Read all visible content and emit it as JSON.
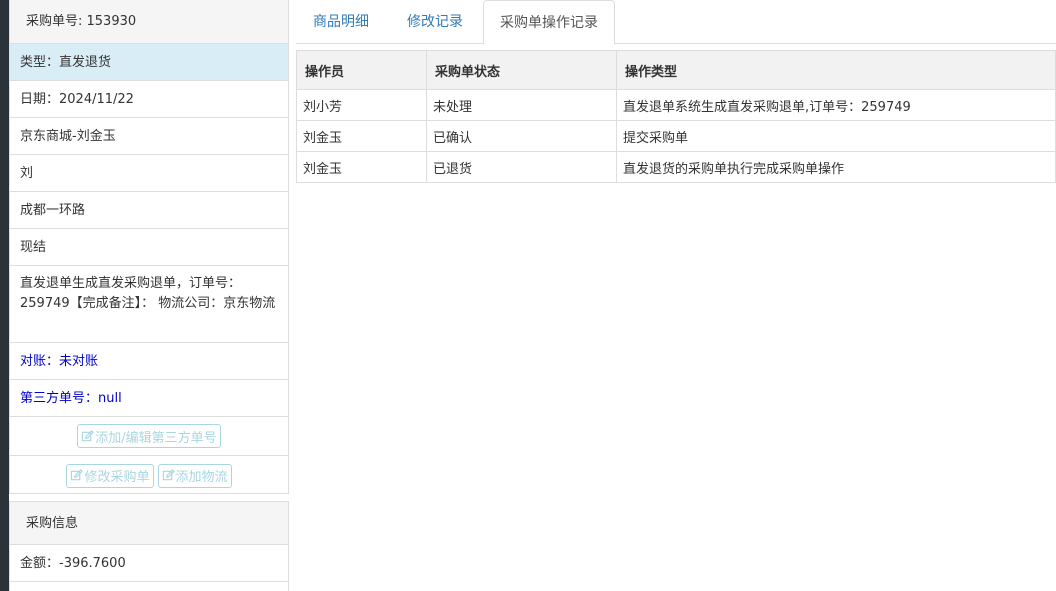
{
  "order": {
    "number_label": "采购单号: 153930",
    "type_label": "类型：",
    "type_value": "直发退货",
    "date": "日期：2024/11/22",
    "store": "京东商城-刘金玉",
    "contact": "刘",
    "address": "成都一环路",
    "settlement": "现结",
    "remark": "直发退单生成直发采购退单，订单号：259749【完成备注】： 物流公司：京东物流",
    "reconcile": "对账：未对账",
    "third_party_no": "第三方单号：null"
  },
  "buttons": {
    "edit_third_party": "添加/编辑第三方单号",
    "modify_order": "修改采购单",
    "add_logistics": "添加物流"
  },
  "purchase_info": {
    "title": "采购信息",
    "amount": "金额：-396.7600"
  },
  "tabs": [
    {
      "label": "商品明细"
    },
    {
      "label": "修改记录"
    },
    {
      "label": "采购单操作记录"
    }
  ],
  "table": {
    "headers": [
      "操作员",
      "采购单状态",
      "操作类型"
    ],
    "rows": [
      [
        "刘小芳",
        "未处理",
        "直发退单系统生成直发采购退单,订单号：259749"
      ],
      [
        "刘金玉",
        "已确认",
        "提交采购单"
      ],
      [
        "刘金玉",
        "已退货",
        "直发退货的采购单执行完成采购单操作"
      ]
    ]
  },
  "colors": {
    "active_item_bg": "#d9edf7",
    "link_blue": "#337ab7",
    "ghost_button": "#a9d6e0",
    "dark_text_blue": "#0000cc"
  }
}
